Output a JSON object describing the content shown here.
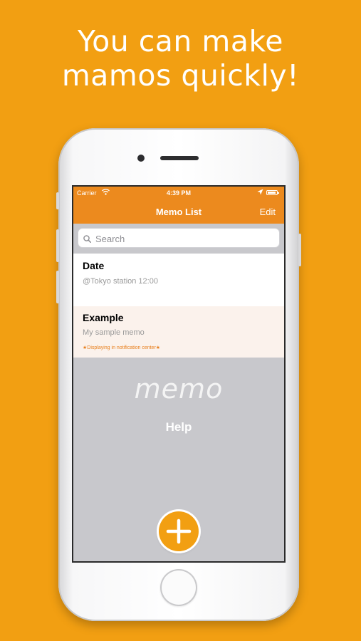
{
  "headline": {
    "line1": "You can make",
    "line2": "mamos quickly!"
  },
  "status_bar": {
    "carrier": "Carrier",
    "time": "4:39 PM"
  },
  "nav": {
    "title": "Memo List",
    "edit_label": "Edit"
  },
  "search": {
    "placeholder": "Search"
  },
  "memos": [
    {
      "title": "Date",
      "body": "@Tokyo station 12:00"
    },
    {
      "title": "Example",
      "body": "My sample memo",
      "notice": "★Displaying in notification center★"
    }
  ],
  "empty_state": {
    "logo": "memo",
    "help_label": "Help"
  },
  "icons": {
    "wifi": "wifi-icon",
    "location": "location-arrow-icon",
    "battery": "battery-icon",
    "search": "search-icon",
    "add": "plus-icon"
  },
  "colors": {
    "background": "#F29F12",
    "nav_bar": "#EC8A1E",
    "highlight_row": "#FBF2EC",
    "notice_text": "#E8801F",
    "list_background": "#C8C8CC"
  }
}
